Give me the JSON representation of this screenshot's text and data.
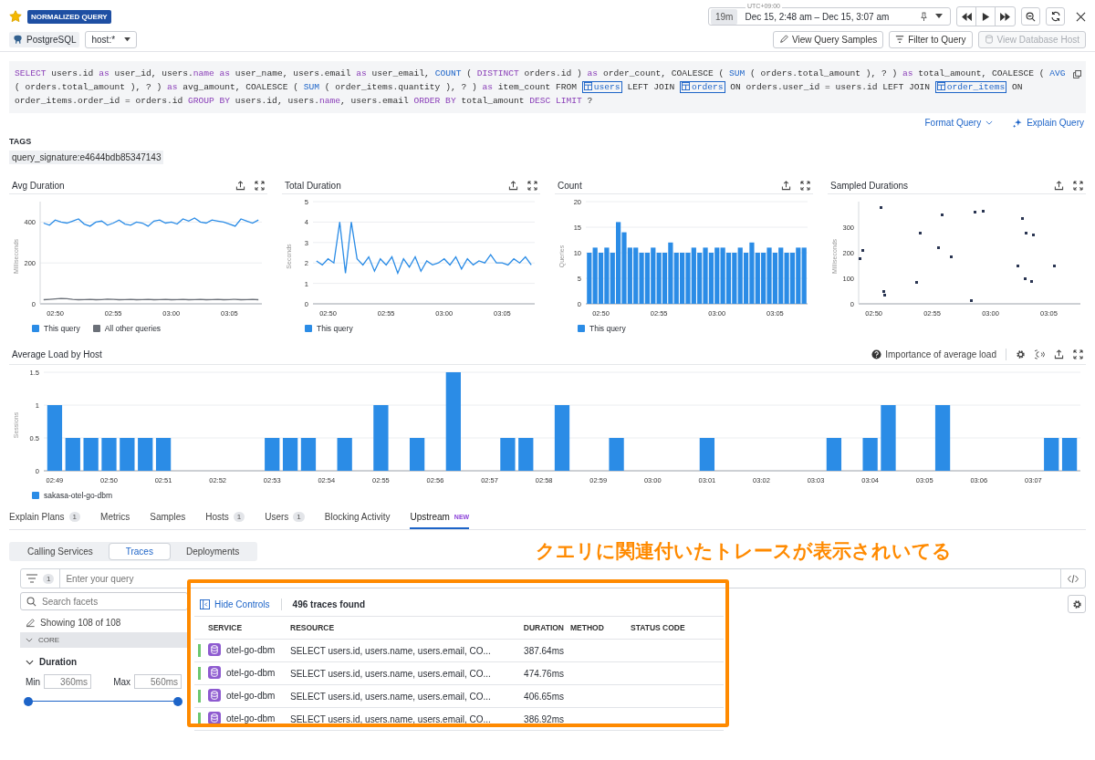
{
  "header": {
    "favorite": true,
    "badge": "NORMALIZED QUERY",
    "database": "PostgreSQL",
    "host_filter": "host:*",
    "timezone": "UTC+09:00",
    "duration": "19m",
    "time_range": "Dec 15, 2:48 am – Dec 15, 3:07 am",
    "actions": [
      {
        "label": "View Query Samples",
        "kind": "pencil",
        "disabled": false
      },
      {
        "label": "Filter to Query",
        "kind": "filter",
        "disabled": false
      },
      {
        "label": "View Database Host",
        "kind": "database",
        "disabled": true
      }
    ]
  },
  "query": {
    "tokens": [
      {
        "kind": "keyword",
        "text": "SELECT"
      },
      {
        "kind": "plain",
        "text": " users.id "
      },
      {
        "kind": "keyword",
        "text": "as"
      },
      {
        "kind": "plain",
        "text": " user_id, users."
      },
      {
        "kind": "keyword",
        "text": "name as"
      },
      {
        "kind": "plain",
        "text": " user_name, users.email "
      },
      {
        "kind": "keyword",
        "text": "as"
      },
      {
        "kind": "plain",
        "text": " user_email, "
      },
      {
        "kind": "function",
        "text": "COUNT"
      },
      {
        "kind": "plain",
        "text": " ( "
      },
      {
        "kind": "keyword",
        "text": "DISTINCT"
      },
      {
        "kind": "plain",
        "text": " orders.id ) "
      },
      {
        "kind": "keyword",
        "text": "as"
      },
      {
        "kind": "plain",
        "text": " order_count, COALESCE ( "
      },
      {
        "kind": "function",
        "text": "SUM"
      },
      {
        "kind": "plain",
        "text": " ( orders.total_amount ), ? ) "
      },
      {
        "kind": "keyword",
        "text": "as"
      },
      {
        "kind": "plain",
        "text": " total_amount, COALESCE ( "
      },
      {
        "kind": "function",
        "text": "AVG"
      },
      {
        "kind": "plain",
        "text": " ( orders.total_amount ), ? ) "
      },
      {
        "kind": "keyword",
        "text": "as"
      },
      {
        "kind": "plain",
        "text": " avg_amount, COALESCE ( "
      },
      {
        "kind": "function",
        "text": "SUM"
      },
      {
        "kind": "plain",
        "text": " ( order_items.quantity ), ? ) "
      },
      {
        "kind": "keyword",
        "text": "as"
      },
      {
        "kind": "plain",
        "text": " item_count FROM "
      },
      {
        "kind": "table",
        "text": "users"
      },
      {
        "kind": "plain",
        "text": " LEFT JOIN "
      },
      {
        "kind": "table",
        "text": "orders"
      },
      {
        "kind": "plain",
        "text": " ON orders.user_id = users.id LEFT JOIN "
      },
      {
        "kind": "table",
        "text": "order_items"
      },
      {
        "kind": "plain",
        "text": " ON order_items.order_id = orders.id "
      },
      {
        "kind": "keyword",
        "text": "GROUP BY"
      },
      {
        "kind": "plain",
        "text": " users.id, users."
      },
      {
        "kind": "keyword",
        "text": "name"
      },
      {
        "kind": "plain",
        "text": ", users.email "
      },
      {
        "kind": "keyword",
        "text": "ORDER BY"
      },
      {
        "kind": "plain",
        "text": " total_amount "
      },
      {
        "kind": "keyword",
        "text": "DESC LIMIT"
      },
      {
        "kind": "plain",
        "text": " ?"
      }
    ]
  },
  "query_actions": {
    "format": "Format Query",
    "explain": "Explain Query"
  },
  "tags": {
    "title": "TAGS",
    "items": [
      "query_signature:e4644bdb85347143"
    ]
  },
  "charts": [
    {
      "title": "Avg Duration",
      "chart_data": {
        "type": "line",
        "ylabel": "Milliseconds",
        "categories": [
          null,
          null,
          "02:50",
          null,
          null,
          null,
          null,
          null,
          null,
          null,
          null,
          null,
          "02:55",
          null,
          null,
          null,
          null,
          null,
          null,
          null,
          null,
          null,
          "03:00",
          null,
          null,
          null,
          null,
          null,
          null,
          null,
          null,
          null,
          "03:05",
          null,
          null,
          null,
          null,
          null
        ],
        "grid": true,
        "ylim": [
          0,
          500
        ],
        "yticks": [
          0,
          200,
          400
        ],
        "series": [
          {
            "name": "This query",
            "color": "#2b8ce6",
            "values": [
              395,
              385,
              410,
              400,
              395,
              405,
              415,
              390,
              380,
              400,
              405,
              385,
              395,
              410,
              390,
              385,
              400,
              395,
              380,
              405,
              410,
              395,
              400,
              390,
              415,
              405,
              420,
              400,
              395,
              410,
              405,
              400,
              390,
              380,
              415,
              405,
              395,
              410
            ]
          },
          {
            "name": "All other queries",
            "color": "#6b7078",
            "values": [
              20,
              22,
              24,
              26,
              25,
              22,
              20,
              21,
              22,
              20,
              21,
              23,
              22,
              20,
              21,
              22,
              20,
              21,
              22,
              20,
              21,
              22,
              20,
              21,
              22,
              20,
              21,
              22,
              20,
              21,
              22,
              20,
              21,
              22,
              20,
              21,
              22,
              20
            ]
          }
        ]
      }
    },
    {
      "title": "Total Duration",
      "chart_data": {
        "type": "line",
        "ylabel": "Seconds",
        "categories": [
          null,
          null,
          "02:50",
          null,
          null,
          null,
          null,
          null,
          null,
          null,
          null,
          null,
          "02:55",
          null,
          null,
          null,
          null,
          null,
          null,
          null,
          null,
          null,
          "03:00",
          null,
          null,
          null,
          null,
          null,
          null,
          null,
          null,
          null,
          "03:05",
          null,
          null,
          null,
          null,
          null
        ],
        "grid": true,
        "ylim": [
          0,
          5
        ],
        "yticks": [
          0,
          1,
          2,
          3,
          4,
          5
        ],
        "series": [
          {
            "name": "This query",
            "color": "#2b8ce6",
            "values": [
              2.1,
              1.9,
              2.2,
              2.0,
              4.0,
              1.5,
              4.0,
              2.2,
              1.9,
              2.3,
              1.6,
              2.2,
              1.9,
              2.3,
              1.5,
              2.2,
              1.8,
              2.3,
              1.6,
              2.1,
              1.9,
              2.0,
              2.2,
              1.9,
              2.3,
              1.7,
              2.2,
              1.9,
              2.1,
              2.0,
              2.4,
              2.0,
              2.0,
              1.9,
              2.2,
              2.0,
              2.3,
              1.9
            ]
          }
        ]
      }
    },
    {
      "title": "Count",
      "chart_data": {
        "type": "bar",
        "ylabel": "Queries",
        "categories": [
          null,
          null,
          "02:50",
          null,
          null,
          null,
          null,
          null,
          null,
          null,
          null,
          null,
          "02:55",
          null,
          null,
          null,
          null,
          null,
          null,
          null,
          null,
          null,
          "03:00",
          null,
          null,
          null,
          null,
          null,
          null,
          null,
          null,
          null,
          "03:05",
          null,
          null,
          null,
          null,
          null
        ],
        "grid": true,
        "ylim": [
          0,
          20
        ],
        "yticks": [
          0,
          5,
          10,
          15,
          20
        ],
        "series": [
          {
            "name": "This query",
            "color": "#2b8ce6",
            "values": [
              10,
              11,
              10,
              11,
              10,
              16,
              14,
              11,
              11,
              10,
              10,
              11,
              10,
              10,
              12,
              10,
              10,
              10,
              11,
              10,
              11,
              10,
              11,
              11,
              10,
              10,
              11,
              10,
              12,
              10,
              10,
              11,
              10,
              11,
              10,
              10,
              11,
              11
            ]
          }
        ]
      }
    },
    {
      "title": "Sampled Durations",
      "chart_data": {
        "type": "scatter",
        "ylabel": "Milliseconds",
        "x": [
          168.8,
          169.0,
          170.6,
          170.8,
          170.9,
          173.6,
          173.9,
          175.5,
          175.8,
          176.6,
          178.3,
          178.6,
          179.3,
          182.3,
          182.7,
          182.9,
          183.0,
          183.5,
          183.6,
          185.4
        ],
        "xlim": [
          168.7,
          187.7
        ],
        "ylim": [
          0,
          400
        ],
        "yticks": [
          0,
          100,
          200,
          300
        ],
        "xticks": [
          {
            "value": 170,
            "label": "02:50"
          },
          {
            "value": 175,
            "label": "02:55"
          },
          {
            "value": 180,
            "label": "03:00"
          },
          {
            "value": 185,
            "label": "03:05"
          }
        ],
        "series": [
          {
            "color": "#2a3552",
            "values": [
              180,
              210,
              380,
              50,
              35,
              85,
              280,
              220,
              350,
              185,
              15,
              360,
              365,
              150,
              335,
              100,
              280,
              90,
              270,
              150
            ]
          }
        ]
      }
    }
  ],
  "load": {
    "title": "Average Load by Host",
    "help": "Importance of average load",
    "chart_data": {
      "type": "bar",
      "ylabel": "Sessions",
      "grid": true,
      "ylim": [
        0,
        1.5
      ],
      "yticks": [
        0,
        0.5,
        1,
        1.5
      ],
      "categories": [
        "02:49",
        null,
        null,
        "02:50",
        null,
        null,
        "02:51",
        null,
        null,
        "02:52",
        null,
        null,
        "02:53",
        null,
        null,
        "02:54",
        null,
        null,
        "02:55",
        null,
        null,
        "02:56",
        null,
        null,
        "02:57",
        null,
        null,
        "02:58",
        null,
        null,
        "02:59",
        null,
        null,
        "03:00",
        null,
        null,
        "03:01",
        null,
        null,
        "03:02",
        null,
        null,
        "03:03",
        null,
        null,
        "03:04",
        null,
        null,
        "03:05",
        null,
        null,
        "03:06",
        null,
        null,
        "03:07",
        null,
        null
      ],
      "series": [
        {
          "name": "sakasa-otel-go-dbm",
          "color": "#2b8ce6",
          "values": [
            1,
            0.5,
            0.5,
            0.5,
            0.5,
            0.5,
            0.5,
            null,
            null,
            null,
            null,
            null,
            0.5,
            0.5,
            0.5,
            null,
            0.5,
            null,
            1,
            null,
            0.5,
            null,
            1.5,
            null,
            null,
            0.5,
            0.5,
            null,
            1,
            null,
            null,
            0.5,
            null,
            null,
            null,
            null,
            0.5,
            null,
            null,
            null,
            null,
            null,
            null,
            0.5,
            null,
            0.5,
            1,
            null,
            null,
            1,
            null,
            null,
            null,
            null,
            null,
            0.5,
            0.5
          ]
        }
      ]
    }
  },
  "tabs": [
    {
      "label": "Explain Plans",
      "count": "1",
      "selected": false
    },
    {
      "label": "Metrics",
      "selected": false
    },
    {
      "label": "Samples",
      "selected": false
    },
    {
      "label": "Hosts",
      "count": "1",
      "selected": false
    },
    {
      "label": "Users",
      "count": "1",
      "selected": false
    },
    {
      "label": "Blocking Activity",
      "selected": false
    },
    {
      "label": "Upstream",
      "badge": "NEW",
      "selected": true
    }
  ],
  "subtabs": [
    {
      "label": "Calling Services",
      "selected": false
    },
    {
      "label": "Traces",
      "selected": true
    },
    {
      "label": "Deployments",
      "selected": false
    }
  ],
  "annotation": "クエリに関連付いたトレースが表示されいてる",
  "search": {
    "filter_count": "1",
    "placeholder": "Enter your query"
  },
  "facets": {
    "placeholder": "Search facets",
    "showing": "Showing 108 of 108",
    "section": {
      "label": "CORE",
      "expanded": true
    },
    "facet": {
      "label": "Duration",
      "expanded": true
    },
    "min_label": "Min",
    "min_placeholder": "360ms",
    "max_label": "Max",
    "max_placeholder": "560ms",
    "level": 1
  },
  "results": {
    "hide_controls": "Hide Controls",
    "count": "496 traces found",
    "columns": [
      "SERVICE",
      "RESOURCE",
      "DURATION",
      "METHOD",
      "STATUS CODE"
    ],
    "rows": [
      {
        "service": "otel-go-dbm",
        "resource": "SELECT users.id, users.name, users.email, CO...",
        "duration": "387.64ms"
      },
      {
        "service": "otel-go-dbm",
        "resource": "SELECT users.id, users.name, users.email, CO...",
        "duration": "474.76ms"
      },
      {
        "service": "otel-go-dbm",
        "resource": "SELECT users.id, users.name, users.email, CO...",
        "duration": "406.65ms"
      },
      {
        "service": "otel-go-dbm",
        "resource": "SELECT users.id, users.name, users.email, CO...",
        "duration": "386.92ms"
      }
    ]
  }
}
